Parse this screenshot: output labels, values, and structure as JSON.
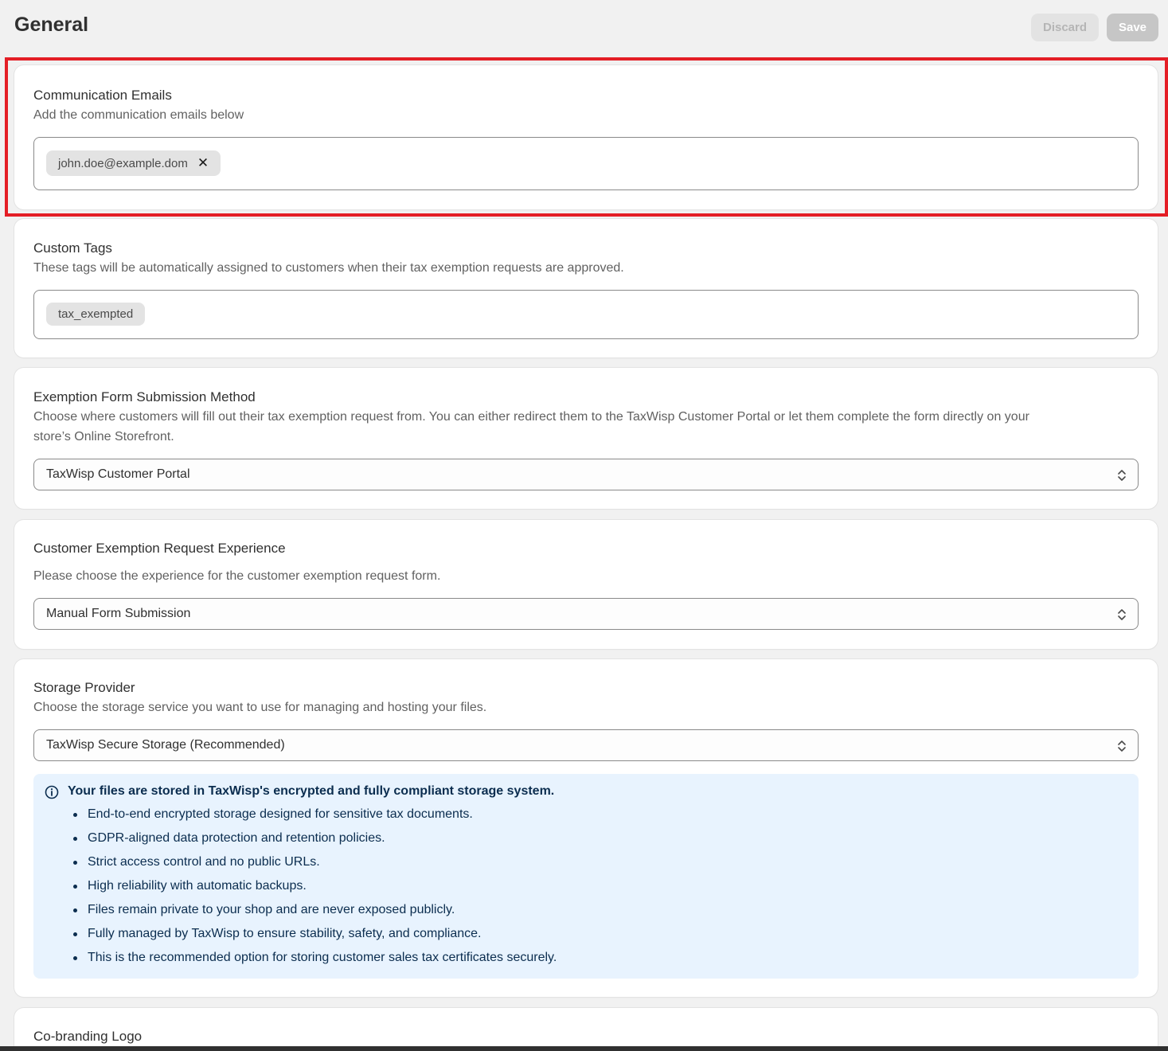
{
  "header": {
    "title": "General",
    "discard_label": "Discard",
    "save_label": "Save"
  },
  "communication_emails": {
    "title": "Communication Emails",
    "subtitle": "Add the communication emails below",
    "chips": [
      "john.doe@example.dom"
    ],
    "remove_icon": "close-icon"
  },
  "custom_tags": {
    "title": "Custom Tags",
    "subtitle": "These tags will be automatically assigned to customers when their tax exemption requests are approved.",
    "chips": [
      "tax_exempted"
    ]
  },
  "submission_method": {
    "title": "Exemption Form Submission Method",
    "subtitle_line1": "Choose where customers will fill out their tax exemption request from. You can either redirect them to the TaxWisp Customer Portal or let them complete the form directly on your",
    "subtitle_line2": "store’s Online Storefront.",
    "selected": "TaxWisp Customer Portal"
  },
  "request_experience": {
    "title": "Customer Exemption Request Experience",
    "subtitle": "Please choose the experience for the customer exemption request form.",
    "selected": "Manual Form Submission"
  },
  "storage_provider": {
    "title": "Storage Provider",
    "subtitle": "Choose the storage service you want to use for managing and hosting your files.",
    "selected": "TaxWisp Secure Storage (Recommended)",
    "banner": {
      "icon": "info-icon",
      "title": "Your files are stored in TaxWisp's encrypted and fully compliant storage system.",
      "items": [
        "End-to-end encrypted storage designed for sensitive tax documents.",
        "GDPR-aligned data protection and retention policies.",
        "Strict access control and no public URLs.",
        "High reliability with automatic backups.",
        "Files remain private to your shop and are never exposed publicly.",
        "Fully managed by TaxWisp to ensure stability, safety, and compliance.",
        "This is the recommended option for storing customer sales tax certificates securely."
      ]
    }
  },
  "co_branding": {
    "title": "Co-branding Logo"
  },
  "colors": {
    "highlight": "#e41e26",
    "banner_bg": "#e8f3fe",
    "banner_text": "#0b2d4f"
  }
}
